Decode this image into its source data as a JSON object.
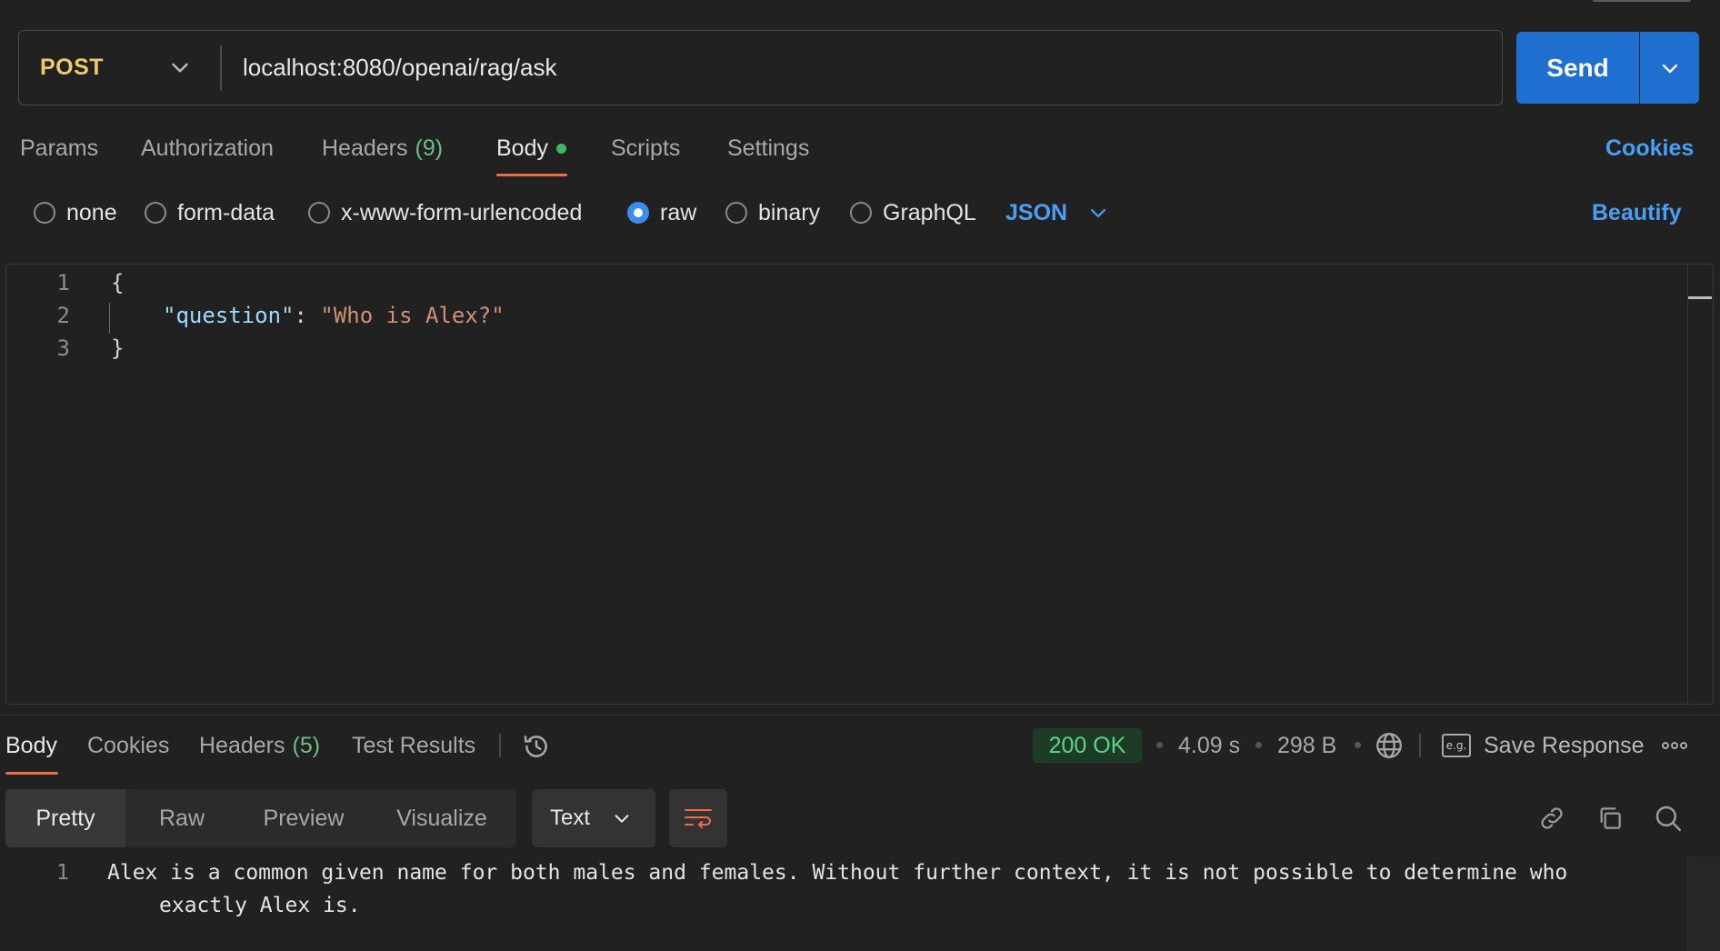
{
  "request": {
    "method": "POST",
    "url": "localhost:8080/openai/rag/ask",
    "send_label": "Send"
  },
  "request_tabs": [
    {
      "label": "Params"
    },
    {
      "label": "Authorization"
    },
    {
      "label": "Headers",
      "count": "(9)"
    },
    {
      "label": "Body",
      "active": true
    },
    {
      "label": "Scripts"
    },
    {
      "label": "Settings"
    }
  ],
  "cookies_label": "Cookies",
  "body_types": [
    {
      "label": "none"
    },
    {
      "label": "form-data"
    },
    {
      "label": "x-www-form-urlencoded"
    },
    {
      "label": "raw",
      "checked": true
    },
    {
      "label": "binary"
    },
    {
      "label": "GraphQL"
    }
  ],
  "body_format": "JSON",
  "beautify_label": "Beautify",
  "editor": {
    "lines": [
      {
        "n": "1",
        "text": "{"
      },
      {
        "n": "2",
        "key": "\"question\"",
        "sep": ": ",
        "value": "\"Who is Alex?\""
      },
      {
        "n": "3",
        "text": "}"
      }
    ]
  },
  "response_tabs": [
    {
      "label": "Body",
      "active": true
    },
    {
      "label": "Cookies"
    },
    {
      "label": "Headers",
      "count": "(5)"
    },
    {
      "label": "Test Results"
    }
  ],
  "response_meta": {
    "status": "200 OK",
    "time": "4.09 s",
    "size": "298 B",
    "save_label": "Save Response",
    "eg_label": "e.g."
  },
  "view_modes": [
    "Pretty",
    "Raw",
    "Preview",
    "Visualize"
  ],
  "response_format": "Text",
  "response_body": {
    "line_no": "1",
    "line1": "Alex is a common given name for both males and females. Without further context, it is not possible to determine who",
    "line2": "exactly Alex is."
  },
  "colors": {
    "accent": "#1f6fd1",
    "method": "#f0c96b",
    "link": "#4a9ff5",
    "tab_underline": "#ef6c4a",
    "status_ok": "#5cd685"
  }
}
